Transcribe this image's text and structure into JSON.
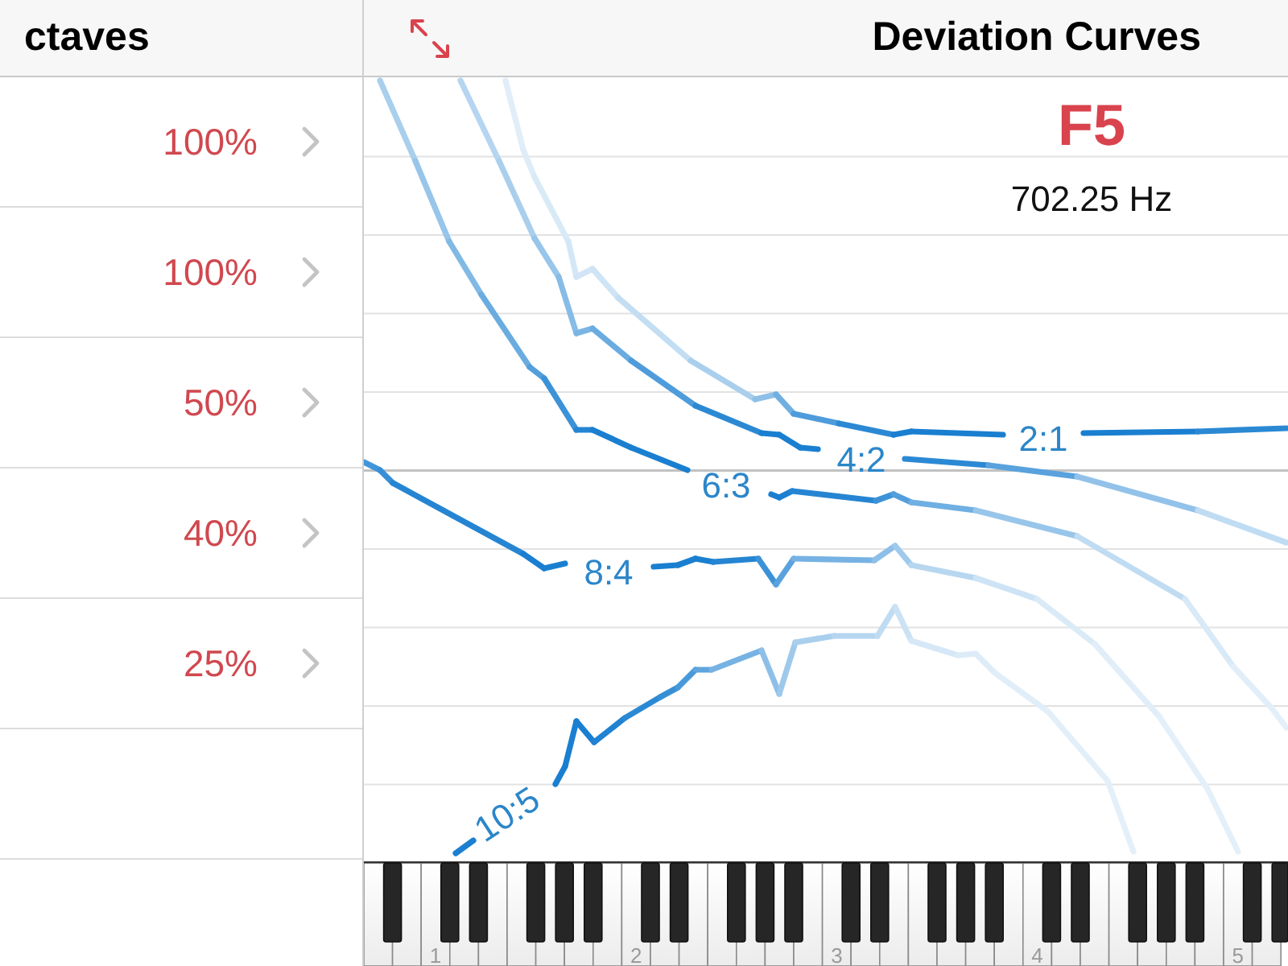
{
  "octaves_panel": {
    "title": "ctaves",
    "rows": [
      {
        "value": "100%"
      },
      {
        "value": "100%"
      },
      {
        "value": "50%"
      },
      {
        "value": "40%"
      },
      {
        "value": "25%"
      }
    ]
  },
  "curves_panel": {
    "title": "Deviation Curves",
    "note": "F5",
    "frequency": "702.25 Hz",
    "curve_labels": [
      "2:1",
      "4:2",
      "6:3",
      "8:4",
      "10:5"
    ],
    "keyboard": {
      "octave_labels": [
        "1",
        "2",
        "3",
        "4",
        "5"
      ]
    }
  }
}
